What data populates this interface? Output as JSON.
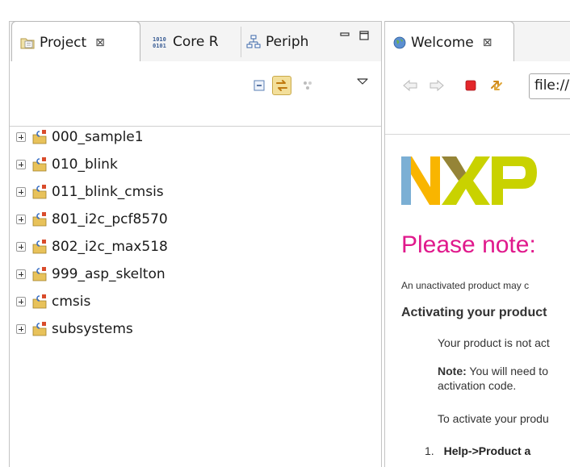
{
  "left_pane": {
    "tabs": [
      {
        "label": "Project",
        "close": "⊠"
      },
      {
        "label": "Core R"
      },
      {
        "label": "Periph"
      }
    ],
    "projects": [
      "000_sample1",
      "010_blink",
      "011_blink_cmsis",
      "801_i2c_pcf8570",
      "802_i2c_max518",
      "999_asp_skelton",
      "cmsis",
      "subsystems"
    ]
  },
  "right_pane": {
    "tab": {
      "label": "Welcome",
      "close": "⊠"
    },
    "url": "file://",
    "welcome": {
      "heading": "Please note: ",
      "intro": "An unactivated product may c",
      "subheading": "Activating your product",
      "p1": "Your product is not act",
      "note_label": "Note:",
      "note_text": " You will need to",
      "note_line2": "activation code.",
      "p2": "To activate your produ",
      "list_number": "1.",
      "list_item": "Help->Product a"
    }
  },
  "colors": {
    "note_heading": "#e0198c",
    "tab_bar": "#f4f4f4",
    "pressed_button": "#f3df9a"
  }
}
